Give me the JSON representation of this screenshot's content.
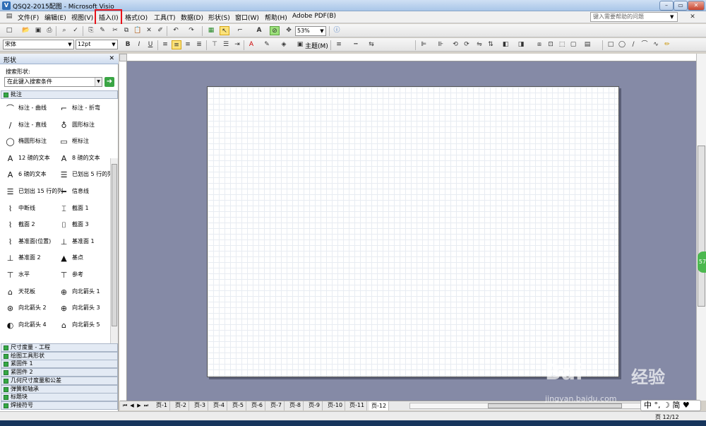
{
  "window": {
    "title": "QSQ2-2015配图 - Microsoft Visio",
    "min": "–",
    "max": "▭",
    "close": "✕"
  },
  "menu": [
    "文件(F)",
    "编辑(E)",
    "视图(V)",
    "插入(I)",
    "格式(O)",
    "工具(T)",
    "数据(D)",
    "形状(S)",
    "窗口(W)",
    "帮助(H)",
    "Adobe PDF(B)"
  ],
  "help_box": {
    "placeholder": "键入需要帮助的问题"
  },
  "toolbar": {
    "zoom": "53%"
  },
  "format_bar": {
    "font": "宋体",
    "size": "12pt",
    "theme": "主题(M)"
  },
  "shapes_panel": {
    "title": "形状",
    "search_label": "搜索形状:",
    "search_placeholder": "在此键入搜索条件",
    "open_stencil": "批注",
    "items": [
      {
        "label": "标注 - 曲线",
        "icon": "⌒"
      },
      {
        "label": "标注 - 折弯",
        "icon": "⌐"
      },
      {
        "label": "标注 - 直线",
        "icon": "∕"
      },
      {
        "label": "圆形标注",
        "icon": "♁"
      },
      {
        "label": "椭圆形标注",
        "icon": "◯"
      },
      {
        "label": "框标注",
        "icon": "▭"
      },
      {
        "label": "12 磅的文本",
        "icon": "A"
      },
      {
        "label": "8 磅的文本",
        "icon": "A"
      },
      {
        "label": "6 磅的文本",
        "icon": "A"
      },
      {
        "label": "已划出 5 行的列",
        "icon": "☰"
      },
      {
        "label": "已划出 15 行的列",
        "icon": "☰"
      },
      {
        "label": "信息线",
        "icon": "━"
      },
      {
        "label": "中断线",
        "icon": "⌇"
      },
      {
        "label": "截面 1",
        "icon": "⌶"
      },
      {
        "label": "截面 2",
        "icon": "⌇"
      },
      {
        "label": "截面 3",
        "icon": "⌷"
      },
      {
        "label": "基准面(位置)",
        "icon": "⌇"
      },
      {
        "label": "基准面 1",
        "icon": "⊥"
      },
      {
        "label": "基准面 2",
        "icon": "⊥"
      },
      {
        "label": "基点",
        "icon": "▲"
      },
      {
        "label": "水平",
        "icon": "⊤"
      },
      {
        "label": "参考",
        "icon": "⊤"
      },
      {
        "label": "天花板",
        "icon": "⌂"
      },
      {
        "label": "向北箭头 1",
        "icon": "⊕"
      },
      {
        "label": "向北箭头 2",
        "icon": "⊛"
      },
      {
        "label": "向北箭头 3",
        "icon": "⊕"
      },
      {
        "label": "向北箭头 4",
        "icon": "◐"
      },
      {
        "label": "向北箭头 5",
        "icon": "⌂"
      }
    ],
    "stencils": [
      "尺寸度量 - 工程",
      "绘图工具形状",
      "紧固件 1",
      "紧固件 2",
      "几何尺寸度量和公差",
      "弹簧和轴承",
      "标题块",
      "焊接符号"
    ]
  },
  "page_tabs": [
    "页-1",
    "页-2",
    "页-3",
    "页-4",
    "页-5",
    "页-6",
    "页-7",
    "页-8",
    "页-9",
    "页-10",
    "页-11",
    "页-12"
  ],
  "status": {
    "page": "页 12/12"
  },
  "ime": {
    "text": "中 °, ☽ 简 ♥"
  },
  "badge": {
    "text": "57"
  },
  "watermark": {
    "brand": "Bai",
    "brand2": "经验",
    "url": "jingyan.baidu.com"
  }
}
